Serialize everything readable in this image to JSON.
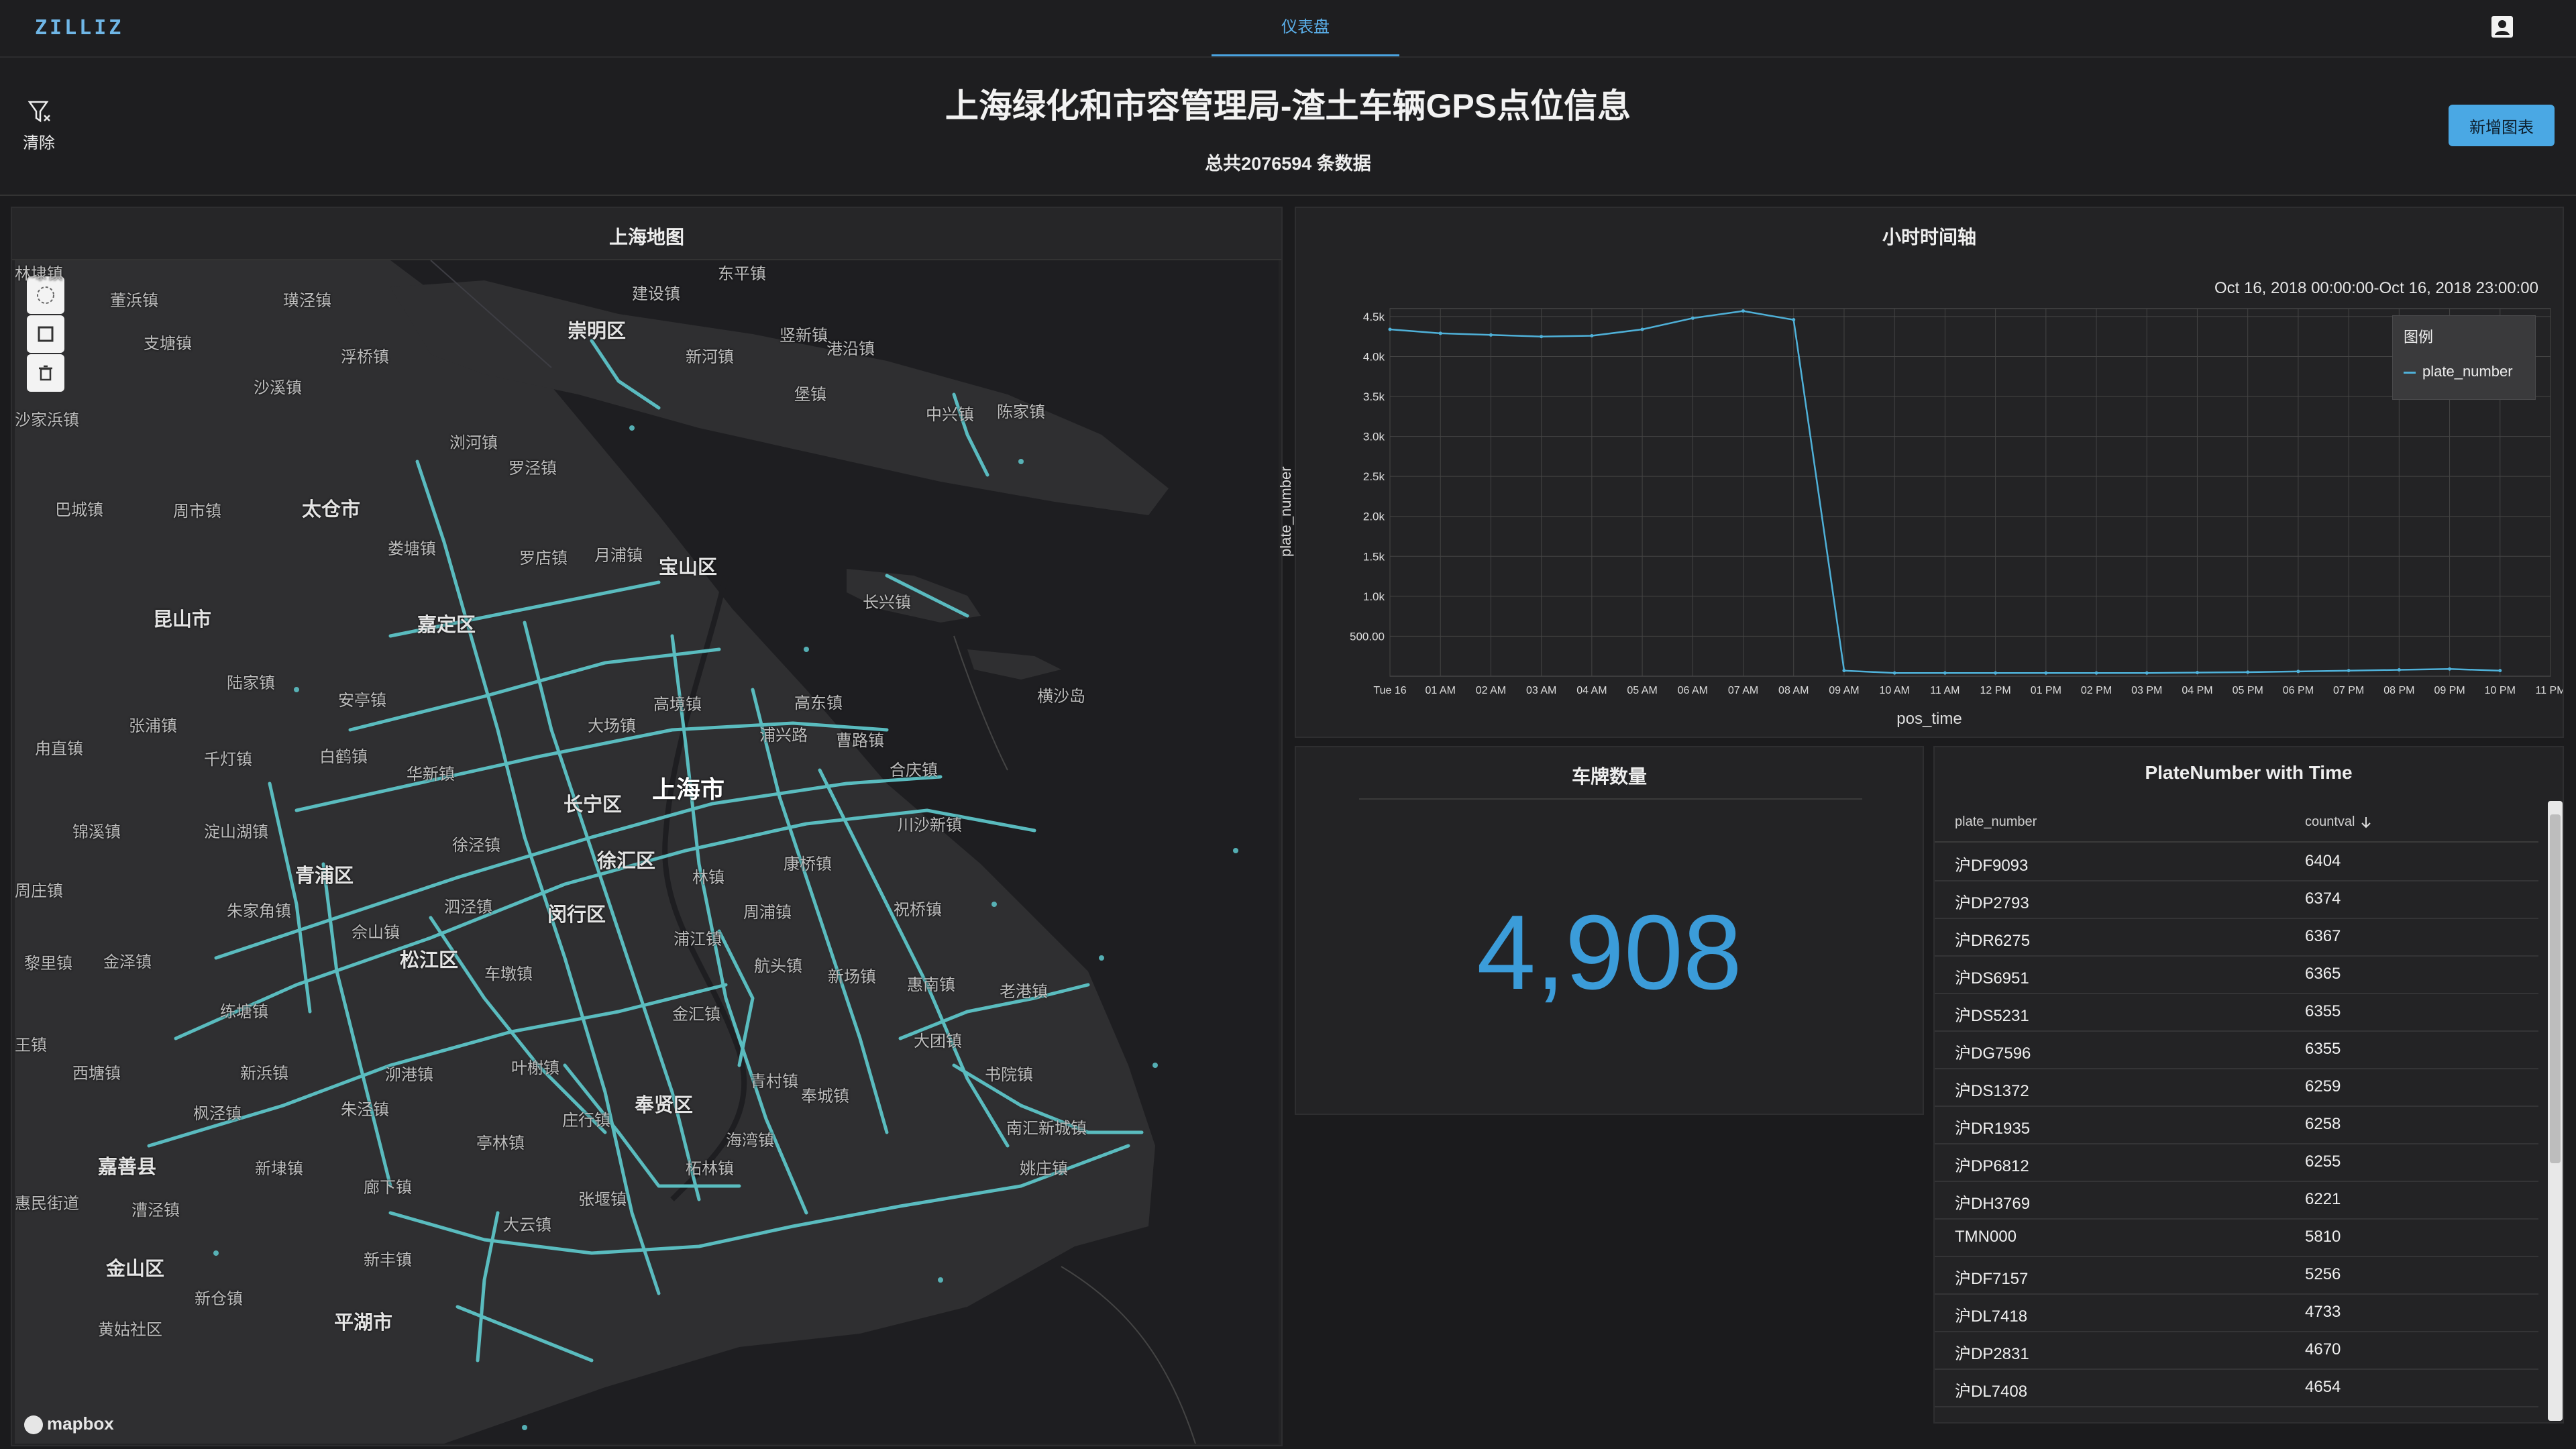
{
  "topbar": {
    "logo": "ZILLIZ",
    "tab_label": "仪表盘",
    "user_icon": "user-icon"
  },
  "header": {
    "clear_label": "清除",
    "clear_icon": "filter-clear-icon",
    "title": "上海绿化和市容管理局-渣土车辆GPS点位信息",
    "subtitle": "总共2076594 条数据",
    "add_chart_label": "新增图表"
  },
  "map": {
    "title": "上海地图",
    "controls": [
      "lasso-select-icon",
      "rectangle-select-icon",
      "trash-icon"
    ],
    "attribution": "mapbox",
    "labels": [
      {
        "text": "东平镇",
        "cls": ""
      },
      {
        "text": "建设镇",
        "cls": ""
      },
      {
        "text": "崇明区",
        "cls": "big"
      },
      {
        "text": "竖新镇",
        "cls": ""
      },
      {
        "text": "新河镇",
        "cls": ""
      },
      {
        "text": "港沿镇",
        "cls": ""
      },
      {
        "text": "堡镇",
        "cls": ""
      },
      {
        "text": "中兴镇",
        "cls": ""
      },
      {
        "text": "陈家镇",
        "cls": ""
      },
      {
        "text": "董浜镇",
        "cls": ""
      },
      {
        "text": "璜泾镇",
        "cls": ""
      },
      {
        "text": "支塘镇",
        "cls": ""
      },
      {
        "text": "浮桥镇",
        "cls": ""
      },
      {
        "text": "沙溪镇",
        "cls": ""
      },
      {
        "text": "沙家浜镇",
        "cls": ""
      },
      {
        "text": "浏河镇",
        "cls": ""
      },
      {
        "text": "罗泾镇",
        "cls": ""
      },
      {
        "text": "巴城镇",
        "cls": ""
      },
      {
        "text": "周市镇",
        "cls": ""
      },
      {
        "text": "太仓市",
        "cls": "big"
      },
      {
        "text": "娄塘镇",
        "cls": ""
      },
      {
        "text": "月浦镇",
        "cls": ""
      },
      {
        "text": "罗店镇",
        "cls": ""
      },
      {
        "text": "宝山区",
        "cls": "big"
      },
      {
        "text": "长兴镇",
        "cls": ""
      },
      {
        "text": "昆山市",
        "cls": "big"
      },
      {
        "text": "嘉定区",
        "cls": "big"
      },
      {
        "text": "陆家镇",
        "cls": ""
      },
      {
        "text": "安亭镇",
        "cls": ""
      },
      {
        "text": "高境镇",
        "cls": ""
      },
      {
        "text": "高东镇",
        "cls": ""
      },
      {
        "text": "横沙岛",
        "cls": ""
      },
      {
        "text": "张浦镇",
        "cls": ""
      },
      {
        "text": "大场镇",
        "cls": ""
      },
      {
        "text": "浦兴路",
        "cls": ""
      },
      {
        "text": "曹路镇",
        "cls": ""
      },
      {
        "text": "甪直镇",
        "cls": ""
      },
      {
        "text": "千灯镇",
        "cls": ""
      },
      {
        "text": "白鹤镇",
        "cls": ""
      },
      {
        "text": "华新镇",
        "cls": ""
      },
      {
        "text": "上海市",
        "cls": "city"
      },
      {
        "text": "合庆镇",
        "cls": ""
      },
      {
        "text": "长宁区",
        "cls": "big"
      },
      {
        "text": "川沙新镇",
        "cls": ""
      },
      {
        "text": "锦溪镇",
        "cls": ""
      },
      {
        "text": "淀山湖镇",
        "cls": ""
      },
      {
        "text": "徐泾镇",
        "cls": ""
      },
      {
        "text": "徐汇区",
        "cls": "big"
      },
      {
        "text": "林镇",
        "cls": ""
      },
      {
        "text": "康桥镇",
        "cls": ""
      },
      {
        "text": "周庄镇",
        "cls": ""
      },
      {
        "text": "青浦区",
        "cls": "big"
      },
      {
        "text": "朱家角镇",
        "cls": ""
      },
      {
        "text": "泗泾镇",
        "cls": ""
      },
      {
        "text": "闵行区",
        "cls": "big"
      },
      {
        "text": "周浦镇",
        "cls": ""
      },
      {
        "text": "祝桥镇",
        "cls": ""
      },
      {
        "text": "佘山镇",
        "cls": ""
      },
      {
        "text": "浦江镇",
        "cls": ""
      },
      {
        "text": "黎里镇",
        "cls": ""
      },
      {
        "text": "金泽镇",
        "cls": ""
      },
      {
        "text": "松江区",
        "cls": "big"
      },
      {
        "text": "车墩镇",
        "cls": ""
      },
      {
        "text": "航头镇",
        "cls": ""
      },
      {
        "text": "新场镇",
        "cls": ""
      },
      {
        "text": "惠南镇",
        "cls": ""
      },
      {
        "text": "老港镇",
        "cls": ""
      },
      {
        "text": "练塘镇",
        "cls": ""
      },
      {
        "text": "金汇镇",
        "cls": ""
      },
      {
        "text": "王镇",
        "cls": ""
      },
      {
        "text": "大团镇",
        "cls": ""
      },
      {
        "text": "西塘镇",
        "cls": ""
      },
      {
        "text": "新浜镇",
        "cls": ""
      },
      {
        "text": "泖港镇",
        "cls": ""
      },
      {
        "text": "叶榭镇",
        "cls": ""
      },
      {
        "text": "书院镇",
        "cls": ""
      },
      {
        "text": "奉贤区",
        "cls": "big"
      },
      {
        "text": "青村镇",
        "cls": ""
      },
      {
        "text": "奉城镇",
        "cls": ""
      },
      {
        "text": "枫泾镇",
        "cls": ""
      },
      {
        "text": "朱泾镇",
        "cls": ""
      },
      {
        "text": "庄行镇",
        "cls": ""
      },
      {
        "text": "南汇新城镇",
        "cls": ""
      },
      {
        "text": "亭林镇",
        "cls": ""
      },
      {
        "text": "海湾镇",
        "cls": ""
      },
      {
        "text": "嘉善县",
        "cls": "big"
      },
      {
        "text": "新埭镇",
        "cls": ""
      },
      {
        "text": "柘林镇",
        "cls": ""
      },
      {
        "text": "姚庄镇",
        "cls": ""
      },
      {
        "text": "惠民街道",
        "cls": ""
      },
      {
        "text": "廊下镇",
        "cls": ""
      },
      {
        "text": "张堰镇",
        "cls": ""
      },
      {
        "text": "漕泾镇",
        "cls": ""
      },
      {
        "text": "大云镇",
        "cls": ""
      },
      {
        "text": "金山区",
        "cls": "big"
      },
      {
        "text": "新丰镇",
        "cls": ""
      },
      {
        "text": "新仓镇",
        "cls": ""
      },
      {
        "text": "平湖市",
        "cls": "big"
      },
      {
        "text": "黄姑社区",
        "cls": ""
      },
      {
        "text": "林埭镇",
        "cls": ""
      }
    ]
  },
  "hourly": {
    "title": "小时时间轴",
    "range": "Oct 16, 2018  00:00:00-Oct 16, 2018  23:00:00",
    "legend_title": "图例"
  },
  "chart_data": {
    "type": "line",
    "xlabel": "pos_time",
    "ylabel": "plate_number",
    "categories": [
      "Tue 16",
      "01 AM",
      "02 AM",
      "03 AM",
      "04 AM",
      "05 AM",
      "06 AM",
      "07 AM",
      "08 AM",
      "09 AM",
      "10 AM",
      "11 AM",
      "12 PM",
      "01 PM",
      "02 PM",
      "03 PM",
      "04 PM",
      "05 PM",
      "06 PM",
      "07 PM",
      "08 PM",
      "09 PM",
      "10 PM",
      "11 PM"
    ],
    "series": [
      {
        "name": "plate_number",
        "values": [
          4340,
          4290,
          4270,
          4250,
          4260,
          4340,
          4480,
          4570,
          4460,
          70,
          40,
          40,
          40,
          40,
          40,
          40,
          45,
          50,
          60,
          70,
          80,
          90,
          70,
          null
        ]
      }
    ],
    "yticks": [
      500,
      1000,
      1500,
      2000,
      2500,
      3000,
      3500,
      4000,
      4500
    ],
    "ytick_labels": [
      "500.00",
      "1.0k",
      "1.5k",
      "2.0k",
      "2.5k",
      "3.0k",
      "3.5k",
      "4.0k",
      "4.5k"
    ],
    "ylim": [
      0,
      4600
    ],
    "grid": true,
    "legend_position": "top-right",
    "color": "#4fb1d9"
  },
  "count": {
    "title": "车牌数量",
    "value": "4,908"
  },
  "plate_table": {
    "title": "PlateNumber with Time",
    "col_plate": "plate_number",
    "col_count": "countval",
    "sort_icon": "arrow-down-icon",
    "rows": [
      {
        "plate": "沪DF9093",
        "count": "6404"
      },
      {
        "plate": "沪DP2793",
        "count": "6374"
      },
      {
        "plate": "沪DR6275",
        "count": "6367"
      },
      {
        "plate": "沪DS6951",
        "count": "6365"
      },
      {
        "plate": "沪DS5231",
        "count": "6355"
      },
      {
        "plate": "沪DG7596",
        "count": "6355"
      },
      {
        "plate": "沪DS1372",
        "count": "6259"
      },
      {
        "plate": "沪DR1935",
        "count": "6258"
      },
      {
        "plate": "沪DP6812",
        "count": "6255"
      },
      {
        "plate": "沪DH3769",
        "count": "6221"
      },
      {
        "plate": "TMN000",
        "count": "5810"
      },
      {
        "plate": "沪DF7157",
        "count": "5256"
      },
      {
        "plate": "沪DL7418",
        "count": "4733"
      },
      {
        "plate": "沪DP2831",
        "count": "4670"
      },
      {
        "plate": "沪DL7408",
        "count": "4654"
      }
    ]
  }
}
